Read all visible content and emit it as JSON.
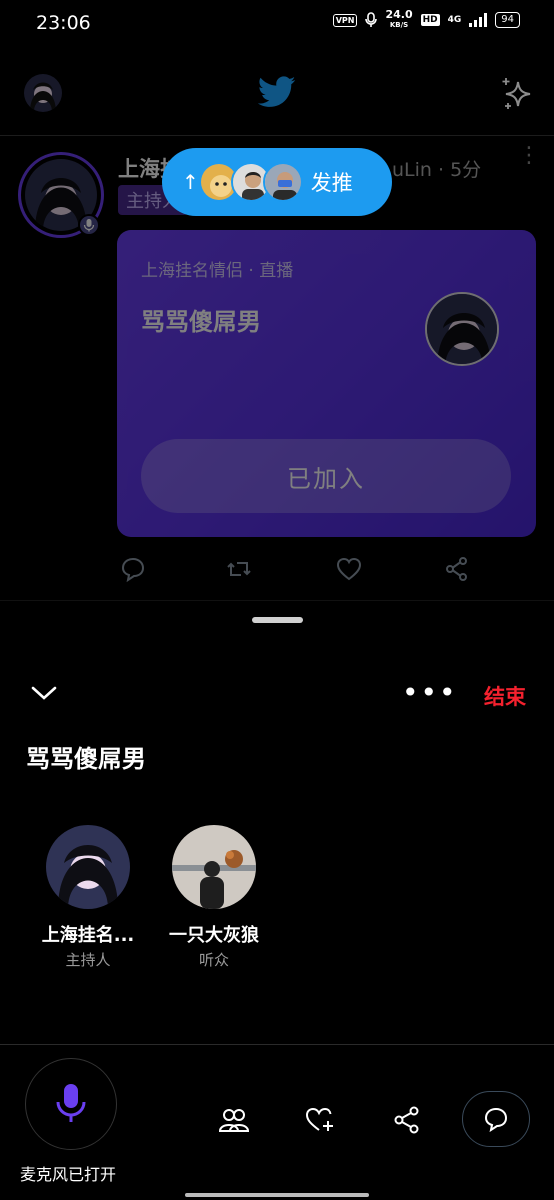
{
  "status_bar": {
    "time": "23:06",
    "vpn": "VPN",
    "speed_value": "24.0",
    "speed_unit": "KB/S",
    "hd": "HD",
    "network": "4G",
    "battery": "94"
  },
  "top_bar": {
    "logo": "twitter-bird-icon",
    "sparkle": "sparkle-icon"
  },
  "feed": {
    "host_name": "上海挂",
    "handle_suffix": "uLin · 5分",
    "host_tag": "主持人",
    "card": {
      "meta": "上海挂名情侣 · 直播",
      "title": "骂骂傻屌男",
      "joined_label": "已加入"
    }
  },
  "new_tweets_pill": {
    "arrow": "↑",
    "label": "发推"
  },
  "sheet": {
    "more_label": "•••",
    "end_label": "结束",
    "title": "骂骂傻屌男",
    "participants": [
      {
        "name": "上海挂名...",
        "role": "主持人"
      },
      {
        "name": "一只大灰狼",
        "role": "听众"
      }
    ],
    "mic_label": "麦克风已打开"
  },
  "colors": {
    "accent": "#1d9bf0",
    "space_purple": "#5b34e6",
    "end_red": "#f4212e"
  }
}
